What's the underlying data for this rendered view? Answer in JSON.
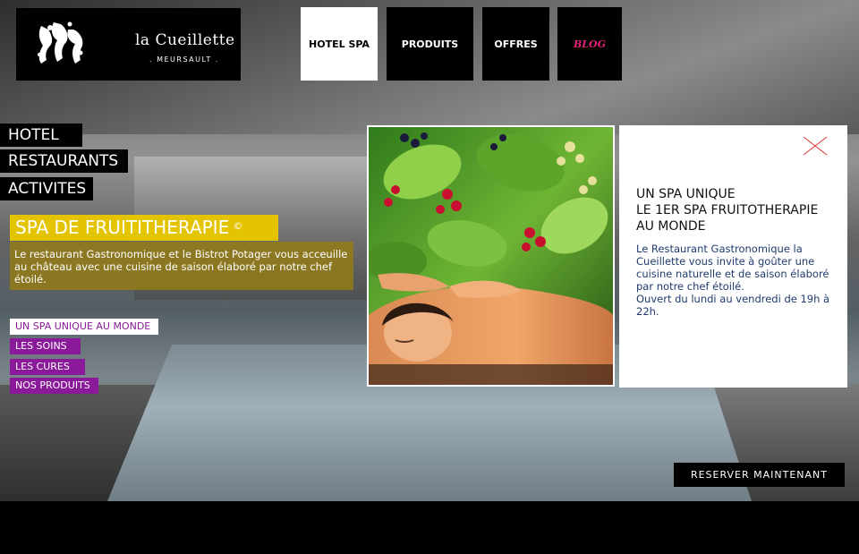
{
  "brand": {
    "name": "la Cueillette",
    "subtitle": ". MEURSAULT ."
  },
  "nav": [
    {
      "label": "HOTEL SPA",
      "active": true
    },
    {
      "label": "PRODUITS",
      "active": false
    },
    {
      "label": "OFFRES",
      "active": false
    },
    {
      "label": "BLOG",
      "active": false
    }
  ],
  "sidebar": {
    "items": [
      {
        "label": "HOTEL"
      },
      {
        "label": "RESTAURANTS"
      },
      {
        "label": "ACTIVITES"
      }
    ]
  },
  "section": {
    "title": "SPA DE FRUITITHERAPIE",
    "title_mark": "©",
    "description": "Le restaurant Gastronomique et le Bistrot Potager vous acceuille au château avec une cuisine de saison élaboré par notre chef étoilé."
  },
  "submenu": [
    {
      "label": "UN SPA UNIQUE AU MONDE",
      "active": true
    },
    {
      "label": "LES SOINS",
      "active": false
    },
    {
      "label": "LES CURES",
      "active": false
    },
    {
      "label": "NOS PRODUITS",
      "active": false
    }
  ],
  "info": {
    "title_lines": [
      "UN SPA UNIQUE",
      "LE 1ER SPA FRUITOTHERAPIE",
      "AU MONDE"
    ],
    "text": "Le Restaurant Gastronomique la Cueillette vous invite à goûter une cuisine naturelle et de saison élaboré par notre chef étoilé.",
    "hours": "Ouvert du lundi au vendredi de 19h à 22h."
  },
  "cta": {
    "label": "RESERVER MAINTENANT"
  },
  "colors": {
    "accent_yellow": "#e4c300",
    "accent_purple": "#8a1a9a",
    "blog_pink": "#e8217a",
    "info_text": "#1f3b6e"
  },
  "icons": {
    "close": "close-icon",
    "logo": "leaf-logo-icon"
  }
}
